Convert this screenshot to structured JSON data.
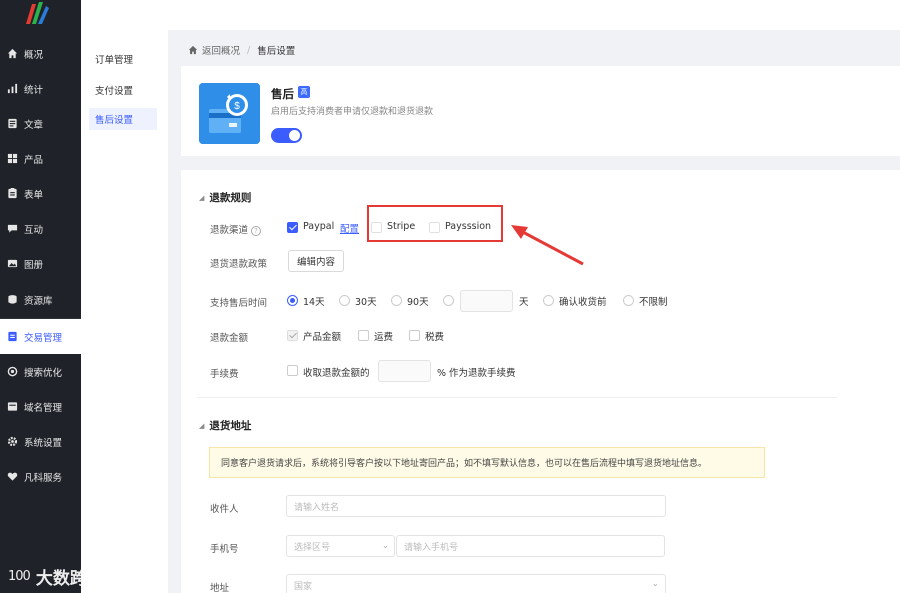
{
  "colors": {
    "sidebar_bg": "#1f2329",
    "accent": "#3b5cff",
    "highlight": "#e53935"
  },
  "sidebar": {
    "items": [
      {
        "label": "概况",
        "icon": "home-icon"
      },
      {
        "label": "统计",
        "icon": "stats-icon"
      },
      {
        "label": "文章",
        "icon": "article-icon"
      },
      {
        "label": "产品",
        "icon": "product-icon"
      },
      {
        "label": "表单",
        "icon": "form-icon"
      },
      {
        "label": "互动",
        "icon": "chat-icon"
      },
      {
        "label": "图册",
        "icon": "gallery-icon"
      },
      {
        "label": "资源库",
        "icon": "library-icon"
      },
      {
        "label": "交易管理",
        "icon": "trade-icon",
        "active": true
      },
      {
        "label": "搜索优化",
        "icon": "seo-icon"
      },
      {
        "label": "域名管理",
        "icon": "domain-icon"
      },
      {
        "label": "系统设置",
        "icon": "gear-icon"
      },
      {
        "label": "凡科服务",
        "icon": "heart-icon"
      }
    ]
  },
  "subnav": {
    "items": [
      {
        "label": "订单管理"
      },
      {
        "label": "支付设置"
      },
      {
        "label": "售后设置",
        "active": true
      }
    ]
  },
  "breadcrumb": {
    "back": "返回概况",
    "separator": "/",
    "current": "售后设置"
  },
  "header": {
    "title": "售后",
    "badge": "高",
    "description": "启用后支持消费者申请仅退款和退货退款",
    "enabled": true
  },
  "refund_rules": {
    "title": "退款规则",
    "channel_label": "退款渠道",
    "channels": [
      {
        "name": "Paypal",
        "checked": true,
        "config_link": "配置"
      },
      {
        "name": "Stripe",
        "checked": false
      },
      {
        "name": "Paysssion",
        "checked": false
      }
    ],
    "policy_label": "退货退款政策",
    "policy_button": "编辑内容",
    "period_label": "支持售后时间",
    "periods": [
      {
        "label": "14天",
        "checked": true
      },
      {
        "label": "30天",
        "checked": false
      },
      {
        "label": "90天",
        "checked": false
      },
      {
        "label": "",
        "checked": false,
        "unit": "天"
      },
      {
        "label": "确认收货前",
        "checked": false
      },
      {
        "label": "不限制",
        "checked": false
      }
    ],
    "amount_label": "退款金额",
    "amounts": [
      {
        "label": "产品金额",
        "checked": true,
        "disabled": true
      },
      {
        "label": "运费",
        "checked": false
      },
      {
        "label": "税费",
        "checked": false
      }
    ],
    "fee_label": "手续费",
    "fee_text_before": "收取退款金额的",
    "fee_text_after": "% 作为退款手续费"
  },
  "return_address": {
    "title": "退货地址",
    "notice": "同意客户退货请求后，系统将引导客户按以下地址寄回产品；如不填写默认信息，也可以在售后流程中填写退货地址信息。",
    "recipient_label": "收件人",
    "recipient_placeholder": "请输入姓名",
    "phone_label": "手机号",
    "area_code_placeholder": "选择区号",
    "phone_placeholder": "请输入手机号",
    "address_label": "地址",
    "country_placeholder": "国家"
  },
  "watermark": {
    "logo_text": "100",
    "brand": "大数跨境"
  }
}
